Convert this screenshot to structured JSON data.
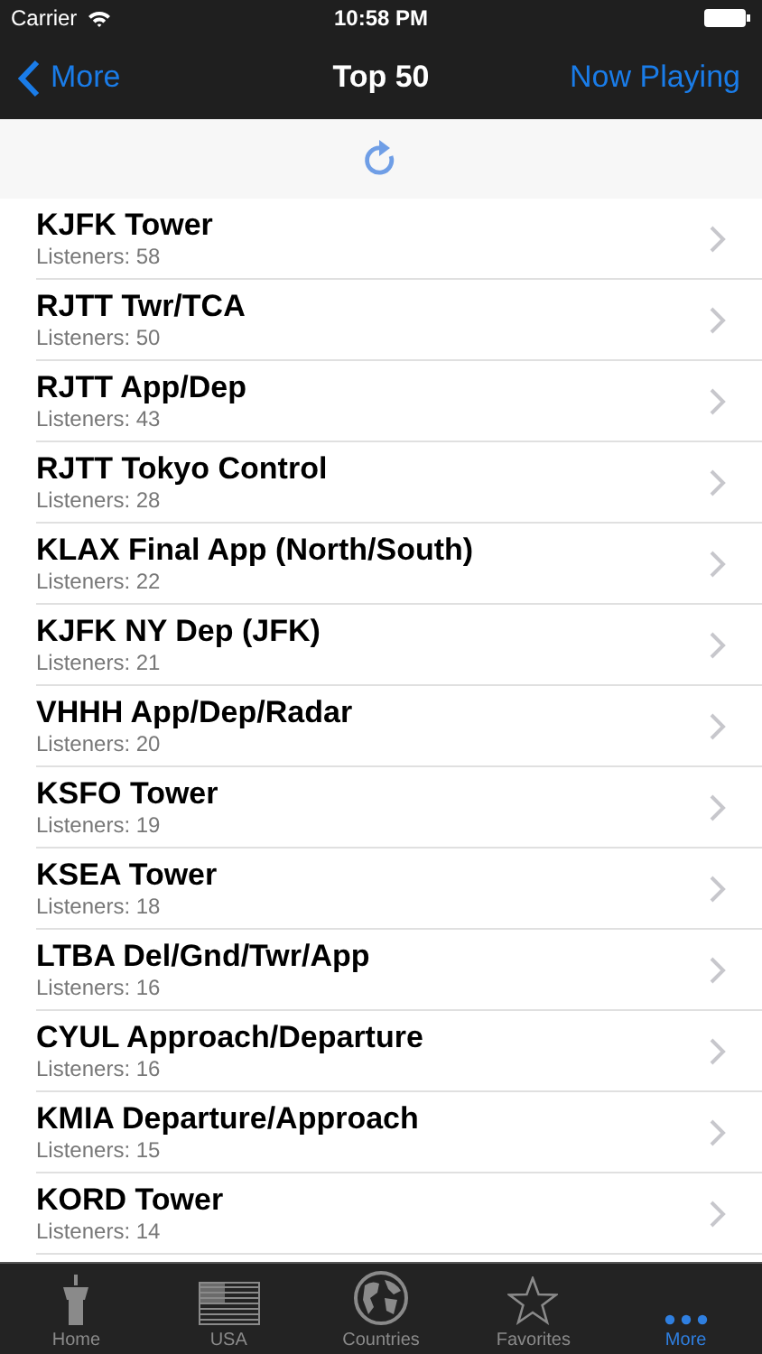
{
  "status_bar": {
    "carrier": "Carrier",
    "time": "10:58 PM"
  },
  "nav": {
    "back": "More",
    "title": "Top 50",
    "action": "Now Playing"
  },
  "rows": [
    {
      "title": "KJFK Tower",
      "subtitle": "Listeners: 58"
    },
    {
      "title": "RJTT Twr/TCA",
      "subtitle": "Listeners: 50"
    },
    {
      "title": "RJTT App/Dep",
      "subtitle": "Listeners: 43"
    },
    {
      "title": "RJTT Tokyo Control",
      "subtitle": "Listeners: 28"
    },
    {
      "title": "KLAX Final App (North/South)",
      "subtitle": "Listeners: 22"
    },
    {
      "title": "KJFK NY Dep (JFK)",
      "subtitle": "Listeners: 21"
    },
    {
      "title": "VHHH App/Dep/Radar",
      "subtitle": "Listeners: 20"
    },
    {
      "title": "KSFO Tower",
      "subtitle": "Listeners: 19"
    },
    {
      "title": "KSEA Tower",
      "subtitle": "Listeners: 18"
    },
    {
      "title": "LTBA Del/Gnd/Twr/App",
      "subtitle": "Listeners: 16"
    },
    {
      "title": "CYUL Approach/Departure",
      "subtitle": "Listeners: 16"
    },
    {
      "title": "KMIA Departure/Approach",
      "subtitle": "Listeners: 15"
    },
    {
      "title": "KORD Tower",
      "subtitle": "Listeners: 14"
    }
  ],
  "tabs": [
    {
      "label": "Home",
      "kind": "tower",
      "selected": false
    },
    {
      "label": "USA",
      "kind": "flag",
      "selected": false
    },
    {
      "label": "Countries",
      "kind": "globe",
      "selected": false
    },
    {
      "label": "Favorites",
      "kind": "star",
      "selected": false
    },
    {
      "label": "More",
      "kind": "more",
      "selected": true
    }
  ]
}
